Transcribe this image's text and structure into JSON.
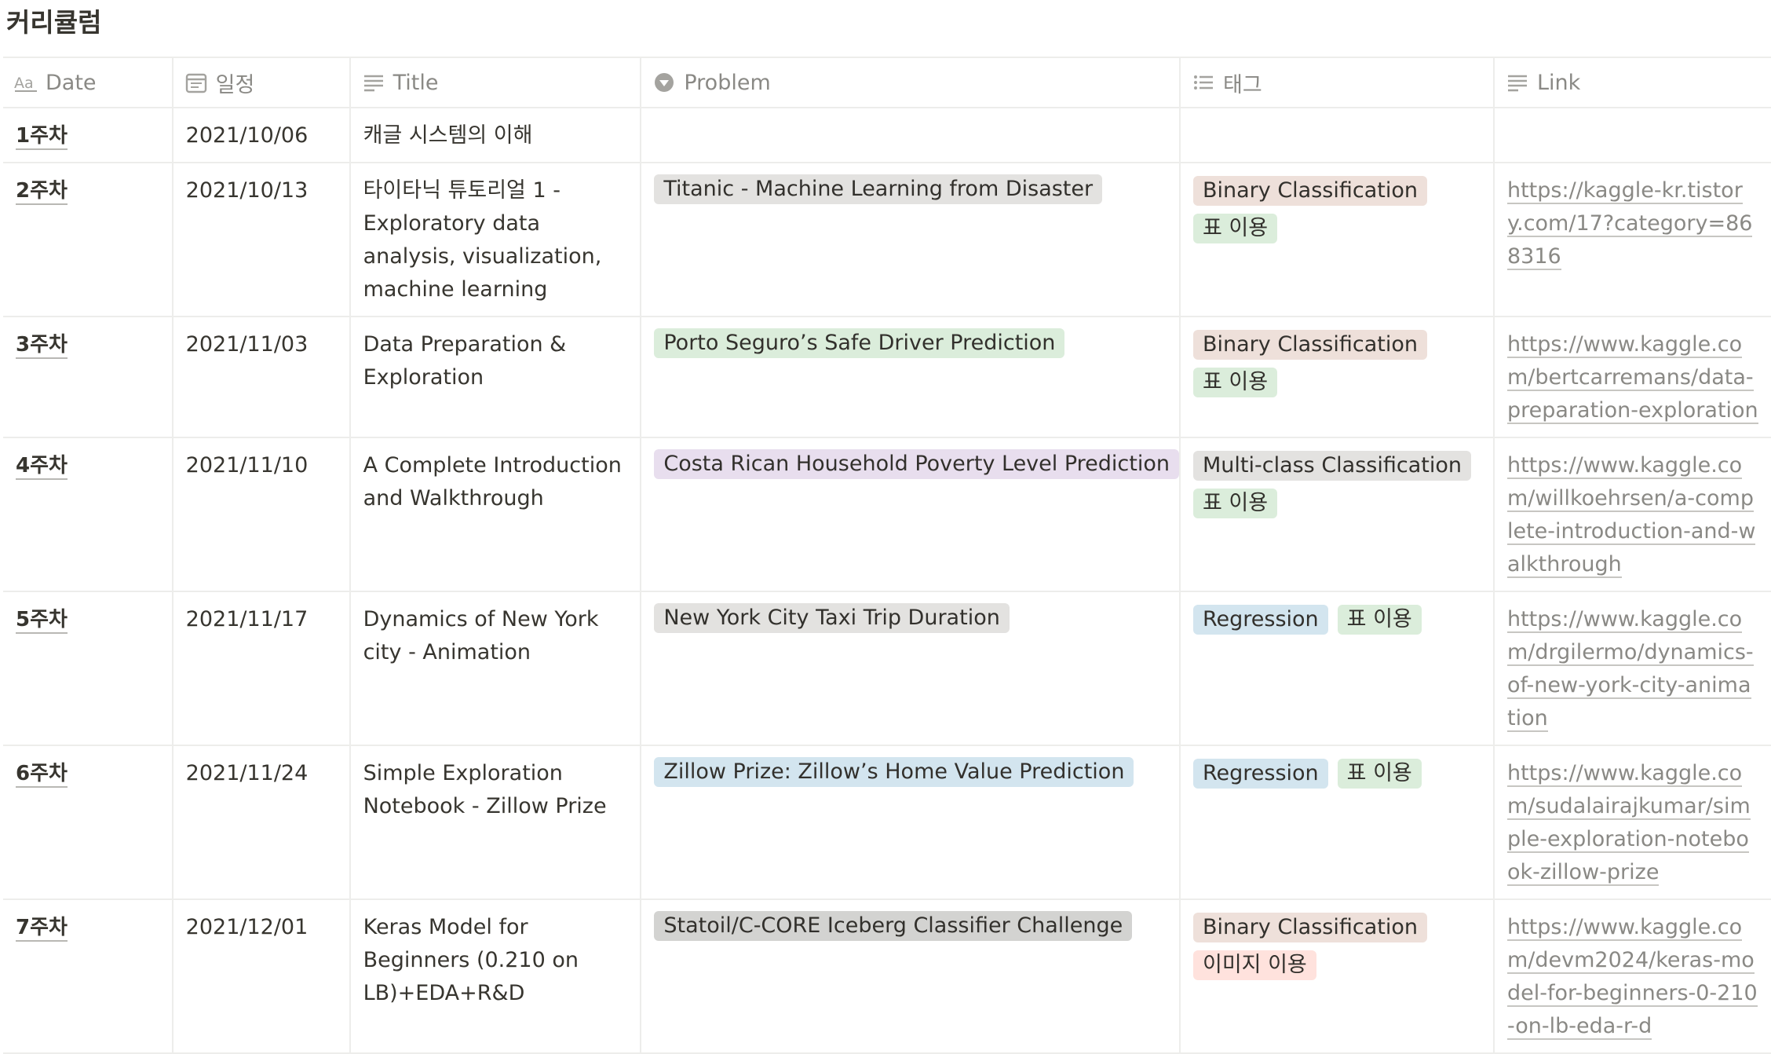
{
  "database": {
    "title": "커리큘럼"
  },
  "columns": [
    {
      "label": "Date",
      "icon": "title-property-icon"
    },
    {
      "label": "일정",
      "icon": "calendar-icon"
    },
    {
      "label": "Title",
      "icon": "text-lines-icon"
    },
    {
      "label": "Problem",
      "icon": "select-property-icon"
    },
    {
      "label": "태그",
      "icon": "multi-select-list-icon"
    },
    {
      "label": "Link",
      "icon": "text-lines-icon"
    }
  ],
  "tag_colors": {
    "gray": "#e3e2e0",
    "green": "#dbeddb",
    "purple": "#e8deee",
    "blue": "#d3e5ef",
    "brown": "#eee0da",
    "red": "#ffe2dd",
    "darkgray": "#d3d3d1"
  },
  "rows": [
    {
      "week": "1주차",
      "date": "2021/10/06",
      "title": "캐글 시스템의 이해",
      "problem": null,
      "tags": [],
      "link": ""
    },
    {
      "week": "2주차",
      "date": "2021/10/13",
      "title": "타이타닉 튜토리얼 1 - Exploratory data analysis, visualization, machine learning",
      "problem": {
        "label": "Titanic - Machine Learning from Disaster",
        "color": "#e3e2e0"
      },
      "tags": [
        {
          "label": "Binary Classification",
          "color": "#eee0da"
        },
        {
          "label": "표 이용",
          "color": "#dbeddb"
        }
      ],
      "link": "https://kaggle-kr.tistory.com/17?category=868316"
    },
    {
      "week": "3주차",
      "date": "2021/11/03",
      "title": "Data Preparation & Exploration",
      "problem": {
        "label": "Porto Seguro’s Safe Driver Prediction",
        "color": "#dbeddb"
      },
      "tags": [
        {
          "label": "Binary Classification",
          "color": "#eee0da"
        },
        {
          "label": "표 이용",
          "color": "#dbeddb"
        }
      ],
      "link": "https://www.kaggle.com/bertcarremans/data-preparation-exploration"
    },
    {
      "week": "4주차",
      "date": "2021/11/10",
      "title": "A Complete Introduction and Walkthrough",
      "problem": {
        "label": "Costa Rican Household Poverty Level Prediction",
        "color": "#e8deee"
      },
      "tags": [
        {
          "label": "Multi-class Classification",
          "color": "#e3e2e0"
        },
        {
          "label": "표 이용",
          "color": "#dbeddb"
        }
      ],
      "link": "https://www.kaggle.com/willkoehrsen/a-complete-introduction-and-walkthrough"
    },
    {
      "week": "5주차",
      "date": "2021/11/17",
      "title": "Dynamics of New York city - Animation",
      "problem": {
        "label": "New York City Taxi Trip Duration",
        "color": "#e3e2e0"
      },
      "tags": [
        {
          "label": "Regression",
          "color": "#d3e5ef"
        },
        {
          "label": "표 이용",
          "color": "#dbeddb"
        }
      ],
      "link": "https://www.kaggle.com/drgilermo/dynamics-of-new-york-city-animation"
    },
    {
      "week": "6주차",
      "date": "2021/11/24",
      "title": "Simple Exploration Notebook - Zillow Prize",
      "problem": {
        "label": "Zillow Prize: Zillow’s Home Value Prediction",
        "color": "#d3e5ef"
      },
      "tags": [
        {
          "label": "Regression",
          "color": "#d3e5ef"
        },
        {
          "label": "표 이용",
          "color": "#dbeddb"
        }
      ],
      "link": "https://www.kaggle.com/sudalairajkumar/simple-exploration-notebook-zillow-prize"
    },
    {
      "week": "7주차",
      "date": "2021/12/01",
      "title": "Keras Model for Beginners (0.210 on LB)+EDA+R&D",
      "problem": {
        "label": "Statoil/C-CORE Iceberg Classifier Challenge",
        "color": "#d3d3d1"
      },
      "tags": [
        {
          "label": "Binary Classification",
          "color": "#eee0da"
        },
        {
          "label": "이미지 이용",
          "color": "#ffe2dd"
        }
      ],
      "link": "https://www.kaggle.com/devm2024/keras-model-for-beginners-0-210-on-lb-eda-r-d"
    }
  ]
}
